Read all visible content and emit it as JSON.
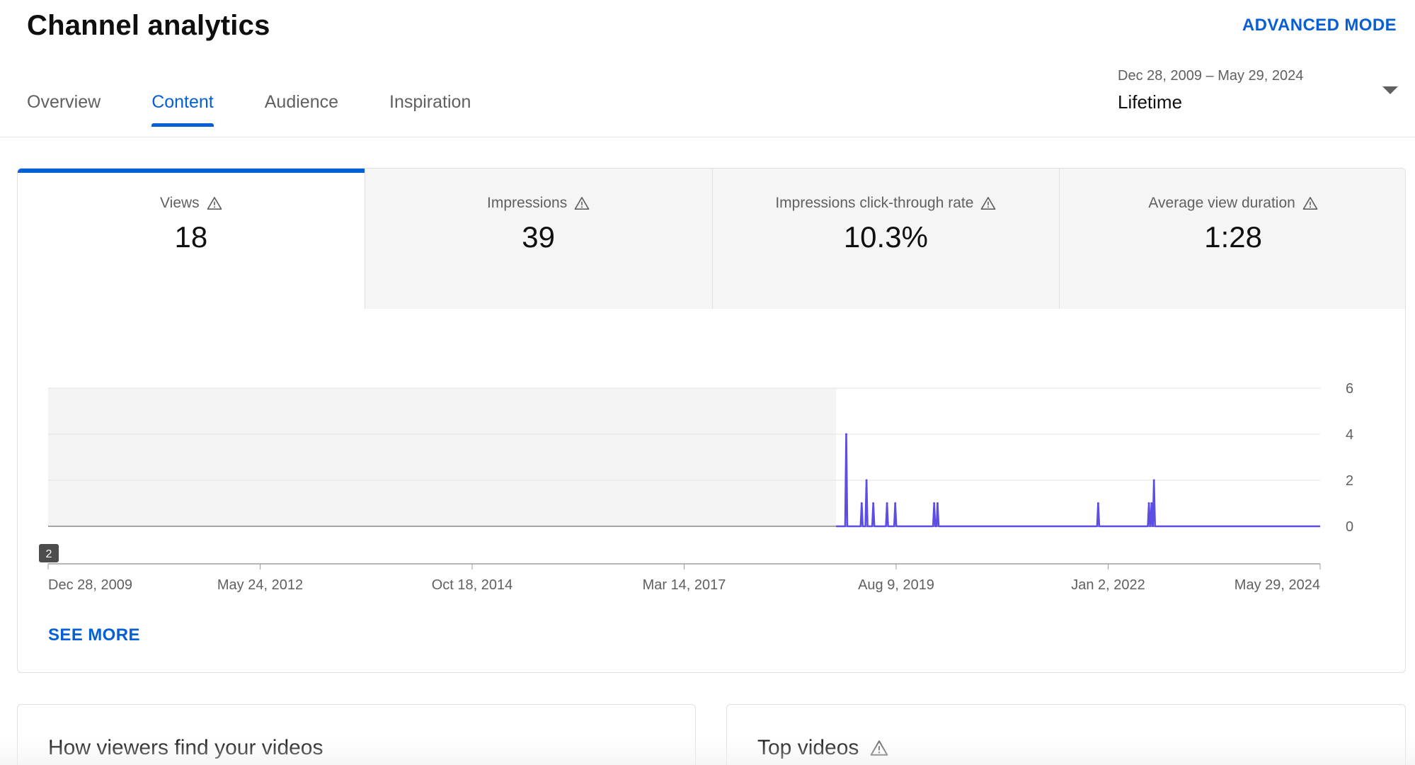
{
  "header": {
    "title": "Channel analytics",
    "advanced_mode": "ADVANCED MODE"
  },
  "tabs": [
    {
      "label": "Overview",
      "active": false
    },
    {
      "label": "Content",
      "active": true
    },
    {
      "label": "Audience",
      "active": false
    },
    {
      "label": "Inspiration",
      "active": false
    }
  ],
  "date_picker": {
    "range": "Dec 28, 2009 – May 29, 2024",
    "label": "Lifetime"
  },
  "metrics": [
    {
      "label": "Views",
      "value": "18",
      "active": true
    },
    {
      "label": "Impressions",
      "value": "39",
      "active": false
    },
    {
      "label": "Impressions click-through rate",
      "value": "10.3%",
      "active": false
    },
    {
      "label": "Average view duration",
      "value": "1:28",
      "active": false
    }
  ],
  "chart_data": {
    "type": "line",
    "x_ticks": [
      "Dec 28, 2009",
      "May 24, 2012",
      "Oct 18, 2014",
      "Mar 14, 2017",
      "Aug 9, 2019",
      "Jan 2, 2022",
      "May 29, 2024"
    ],
    "y_ticks": [
      "6",
      "4",
      "2",
      "0"
    ],
    "ylim": [
      0,
      6
    ],
    "x_range": [
      "2009-12-28",
      "2024-05-29"
    ],
    "data_start": "2018-12-03",
    "grid": true,
    "marker_badge": "2",
    "color": "#5c4ee5",
    "shaded_region_color": "#f4f4f4",
    "series": [
      {
        "points": [
          {
            "date": "2018-12-03",
            "value": 0
          },
          {
            "date": "2019-01-14",
            "value": 4
          },
          {
            "date": "2019-03-19",
            "value": 1
          },
          {
            "date": "2019-04-08",
            "value": 2
          },
          {
            "date": "2019-05-06",
            "value": 1
          },
          {
            "date": "2019-07-02",
            "value": 1
          },
          {
            "date": "2019-08-05",
            "value": 1
          },
          {
            "date": "2020-01-13",
            "value": 1
          },
          {
            "date": "2020-01-27",
            "value": 1
          },
          {
            "date": "2021-11-22",
            "value": 1
          },
          {
            "date": "2022-06-20",
            "value": 1
          },
          {
            "date": "2022-07-01",
            "value": 1
          },
          {
            "date": "2022-07-11",
            "value": 2
          },
          {
            "date": "2024-05-29",
            "value": 0
          }
        ]
      }
    ]
  },
  "see_more": "SEE MORE",
  "bottom_cards": {
    "left_title": "How viewers find your videos",
    "right_title": "Top videos"
  }
}
